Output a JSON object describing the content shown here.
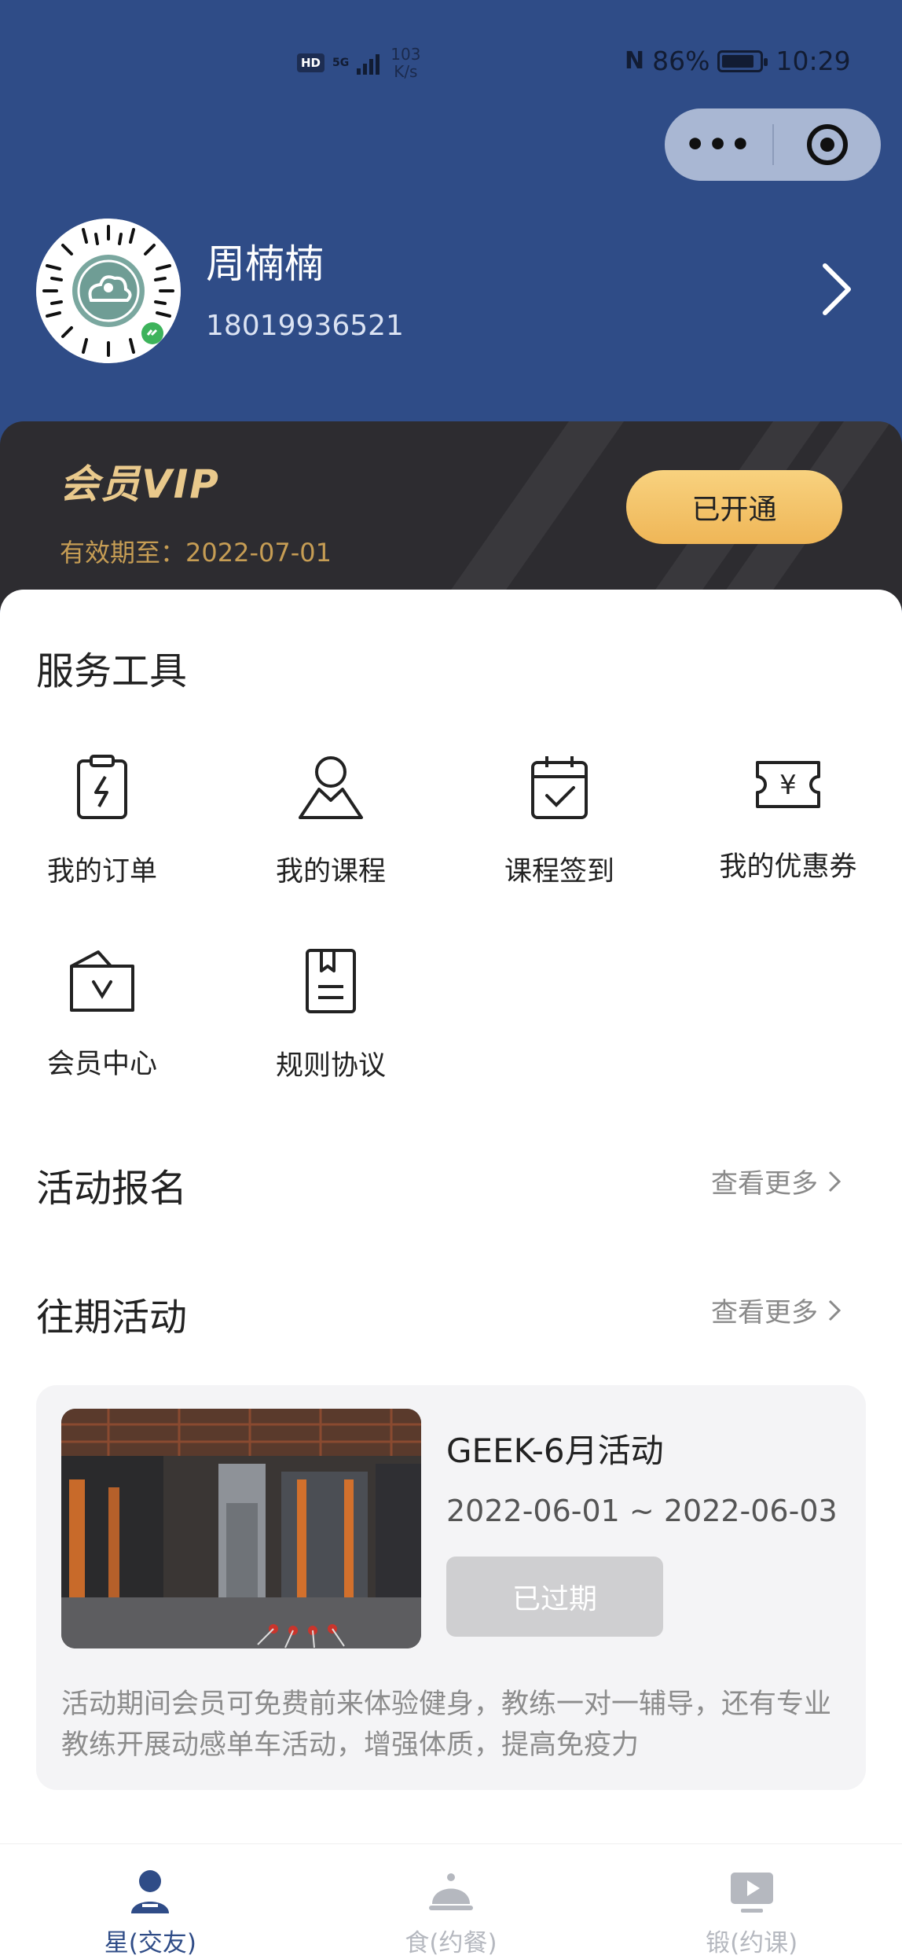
{
  "status_bar": {
    "hd": "HD",
    "network": "5G",
    "speed_value": "103",
    "speed_unit": "K/s",
    "nfc": "N",
    "battery": "86%",
    "time": "10:29"
  },
  "capsule": {
    "more_icon": "more-dots-icon",
    "close_icon": "target-close-icon"
  },
  "profile": {
    "name": "周楠楠",
    "phone": "18019936521"
  },
  "vip": {
    "title": "会员VIP",
    "expiry": "有效期至：2022-07-01",
    "button_label": "已开通"
  },
  "services": {
    "title": "服务工具",
    "items": [
      {
        "label": "我的订单",
        "icon": "order-icon"
      },
      {
        "label": "我的课程",
        "icon": "course-icon"
      },
      {
        "label": "课程签到",
        "icon": "calendar-check-icon"
      },
      {
        "label": "我的优惠券",
        "icon": "coupon-icon"
      },
      {
        "label": "会员中心",
        "icon": "member-bag-icon"
      },
      {
        "label": "规则协议",
        "icon": "rules-book-icon"
      }
    ]
  },
  "signup": {
    "title": "活动报名",
    "more_label": "查看更多"
  },
  "past": {
    "title": "往期活动",
    "more_label": "查看更多",
    "card": {
      "title": "GEEK-6月活动",
      "dates": "2022-06-01 ~ 2022-06-03",
      "status": "已过期",
      "description": "活动期间会员可免费前来体验健身，教练一对一辅导，还有专业教练开展动感单车活动，增强体质，提高免疫力"
    }
  },
  "tabbar": {
    "tabs": [
      {
        "label": "星(交友)",
        "icon": "person-icon",
        "active": true
      },
      {
        "label": "食(约餐)",
        "icon": "dish-cover-icon",
        "active": false
      },
      {
        "label": "锻(约课)",
        "icon": "video-play-icon",
        "active": false
      }
    ]
  },
  "colors": {
    "header_bg": "#2f4c87",
    "vip_bg": "#2d2c30",
    "vip_gold": "#e9c98c",
    "button_gold": "#f3c46a",
    "tab_active": "#2f4c87",
    "tab_inactive": "#b5b8bf"
  }
}
